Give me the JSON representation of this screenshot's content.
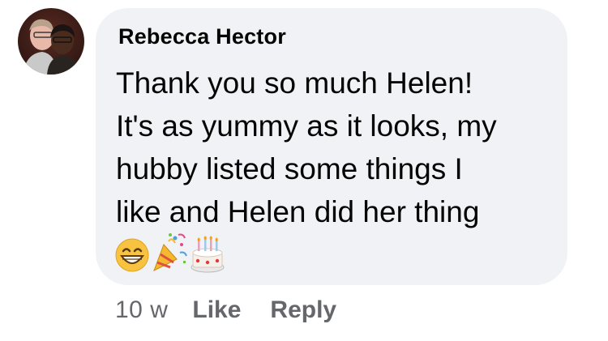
{
  "comment": {
    "author": "Rebecca Hector",
    "text_lines": [
      "Thank you so much Helen!",
      "It's as yummy as it looks, my",
      "hubby listed some things I",
      "like and Helen did her thing"
    ],
    "emojis": [
      "grinning-face-emoji",
      "party-popper-emoji",
      "birthday-cake-emoji"
    ],
    "timestamp": "10 w",
    "like_label": "Like",
    "reply_label": "Reply"
  },
  "colors": {
    "bubble_background": "#f0f2f5",
    "text_primary": "#050505",
    "text_secondary": "#65676b"
  }
}
